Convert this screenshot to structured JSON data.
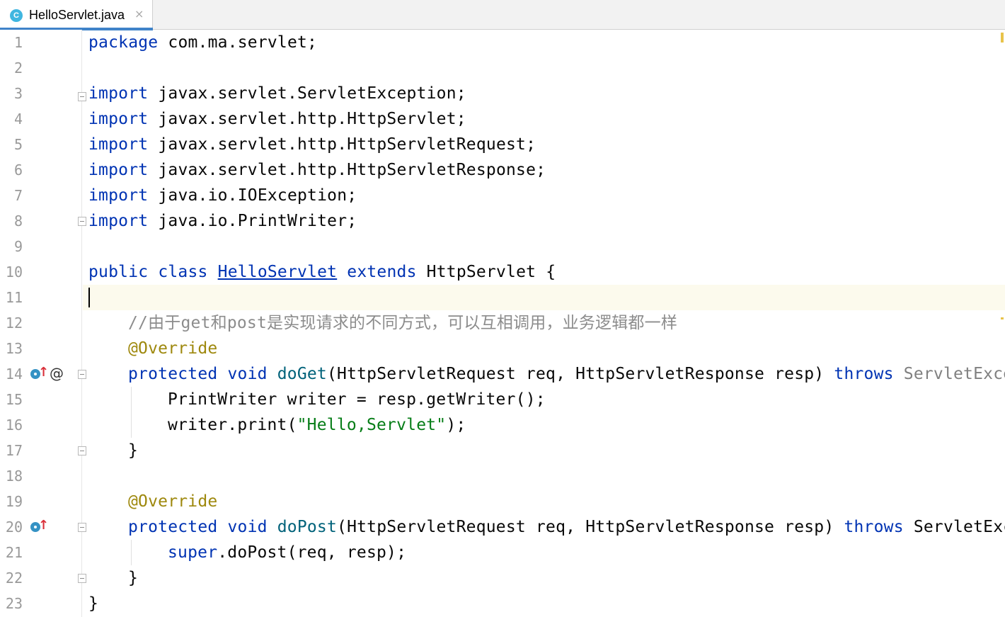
{
  "tab": {
    "icon_letter": "C",
    "label": "HelloServlet.java",
    "close_glyph": "×"
  },
  "colors": {
    "keyword": "#0033b3",
    "annotation": "#9e880d",
    "method": "#00627a",
    "string": "#067d17",
    "comment": "#8c8c8c",
    "current_line": "#fcfaed",
    "tab_accent": "#4083c9"
  },
  "gutter": {
    "line_numbers": [
      "1",
      "2",
      "3",
      "4",
      "5",
      "6",
      "7",
      "8",
      "9",
      "10",
      "11",
      "12",
      "13",
      "14",
      "15",
      "16",
      "17",
      "18",
      "19",
      "20",
      "21",
      "22",
      "23"
    ],
    "override_icon_glyph": "↑",
    "annotation_glyph": "@"
  },
  "code": {
    "l1": {
      "kw": "package",
      "rest": " com.ma.servlet;"
    },
    "l3": {
      "kw": "import",
      "rest": " javax.servlet.ServletException;"
    },
    "l4": {
      "kw": "import",
      "rest": " javax.servlet.http.HttpServlet;"
    },
    "l5": {
      "kw": "import",
      "rest": " javax.servlet.http.HttpServletRequest;"
    },
    "l6": {
      "kw": "import",
      "rest": " javax.servlet.http.HttpServletResponse;"
    },
    "l7": {
      "kw": "import",
      "rest": " java.io.IOException;"
    },
    "l8": {
      "kw": "import",
      "rest": " java.io.PrintWriter;"
    },
    "l10": {
      "kw1": "public class",
      "cls": "HelloServlet",
      "kw2": "extends",
      "rest": " HttpServlet {"
    },
    "l12": {
      "comment": "//由于get和post是实现请求的不同方式，可以互相调用，业务逻辑都一样"
    },
    "l13": {
      "annot": "@Override"
    },
    "l14": {
      "kw": "protected void",
      "method": "doGet",
      "params": "(HttpServletRequest req, HttpServletResponse resp)",
      "throws": "throws",
      "exc": "ServletExce"
    },
    "l15": {
      "text": "PrintWriter writer = resp.getWriter();"
    },
    "l16": {
      "pre": "writer.print(",
      "str": "\"Hello,Servlet\"",
      "post": ");"
    },
    "l17": {
      "text": "}"
    },
    "l19": {
      "annot": "@Override"
    },
    "l20": {
      "kw": "protected void",
      "method": "doPost",
      "params": "(HttpServletRequest req, HttpServletResponse resp)",
      "throws": "throws",
      "exc": "ServletExc"
    },
    "l21": {
      "kw": "super",
      "rest": ".doPost(req, resp);"
    },
    "l22": {
      "text": "}"
    },
    "l23": {
      "text": "}"
    }
  }
}
